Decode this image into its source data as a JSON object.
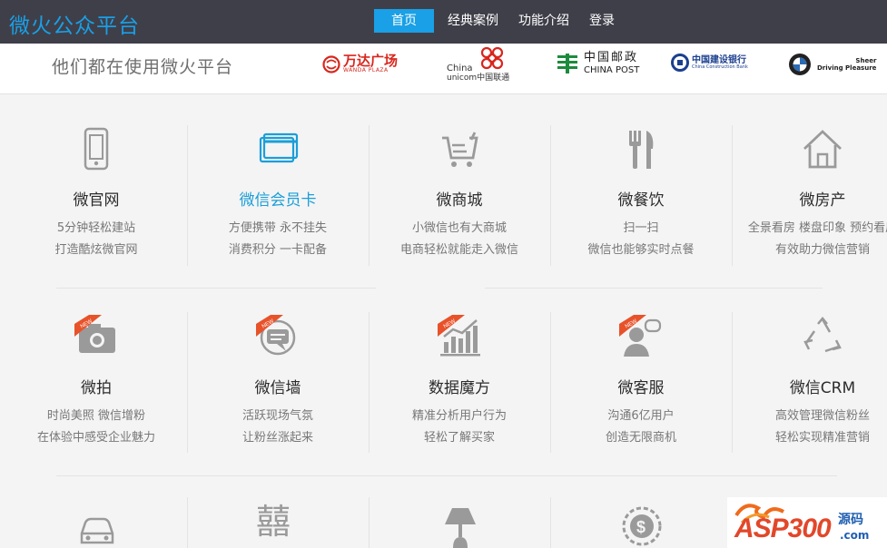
{
  "header": {
    "brand": "微火公众平台",
    "nav": [
      {
        "label": "首页"
      },
      {
        "label": "经典案例"
      },
      {
        "label": "功能介绍"
      },
      {
        "label": "登录"
      }
    ]
  },
  "partners": {
    "title": "他们都在使用微火平台",
    "wanda": {
      "cn": "万达广场",
      "en": "WANDA PLAZA"
    },
    "unicom": {
      "top": "China",
      "bottom": "unicom中国联通"
    },
    "post": {
      "cn": "中国邮政",
      "en": "CHINA POST"
    },
    "ccb": {
      "cn": "中国建设银行",
      "en": "China Construction Bank"
    },
    "bmw": {
      "line1": "Sheer",
      "line2": "Driving Pleasure"
    }
  },
  "features": [
    {
      "name": "微官网",
      "desc1": "5分钟轻松建站",
      "desc2": "打造酷炫微官网",
      "icon": "phone-icon"
    },
    {
      "name": "微信会员卡",
      "desc1": "方便携带 永不挂失",
      "desc2": "消费积分 一卡配备",
      "icon": "card-icon"
    },
    {
      "name": "微商城",
      "desc1": "小微信也有大商城",
      "desc2": "电商轻松就能走入微信",
      "icon": "cart-icon"
    },
    {
      "name": "微餐饮",
      "desc1": "扫一扫",
      "desc2": "微信也能够实时点餐",
      "icon": "cutlery-icon"
    },
    {
      "name": "微房产",
      "desc1": "全景看房 楼盘印象 预约看房",
      "desc2": "有效助力微信营销",
      "icon": "house-icon"
    },
    {
      "name": "微拍",
      "desc1": "时尚美照 微信增粉",
      "desc2": "在体验中感受企业魅力",
      "icon": "camera-icon",
      "badge": "NEW"
    },
    {
      "name": "微信墙",
      "desc1": "活跃现场气氛",
      "desc2": "让粉丝涨起来",
      "icon": "chat-icon",
      "badge": "NEW"
    },
    {
      "name": "数据魔方",
      "desc1": "精准分析用户行为",
      "desc2": "轻松了解买家",
      "icon": "bar-chart-icon",
      "badge": "NEW"
    },
    {
      "name": "微客服",
      "desc1": "沟通6亿用户",
      "desc2": "创造无限商机",
      "icon": "support-icon",
      "badge": "NEW"
    },
    {
      "name": "微信CRM",
      "desc1": "高效管理微信粉丝",
      "desc2": "轻松实现精准营销",
      "icon": "recycle-icon"
    }
  ],
  "row3_glyph": "囍",
  "watermark": {
    "text": "ASP300",
    "suffix": "源码",
    "domain": ".com"
  },
  "colors": {
    "topbar": "#3f3f4a",
    "accent": "#19a0e6",
    "badge": "#e8522a",
    "icon": "#9a9a9a"
  }
}
